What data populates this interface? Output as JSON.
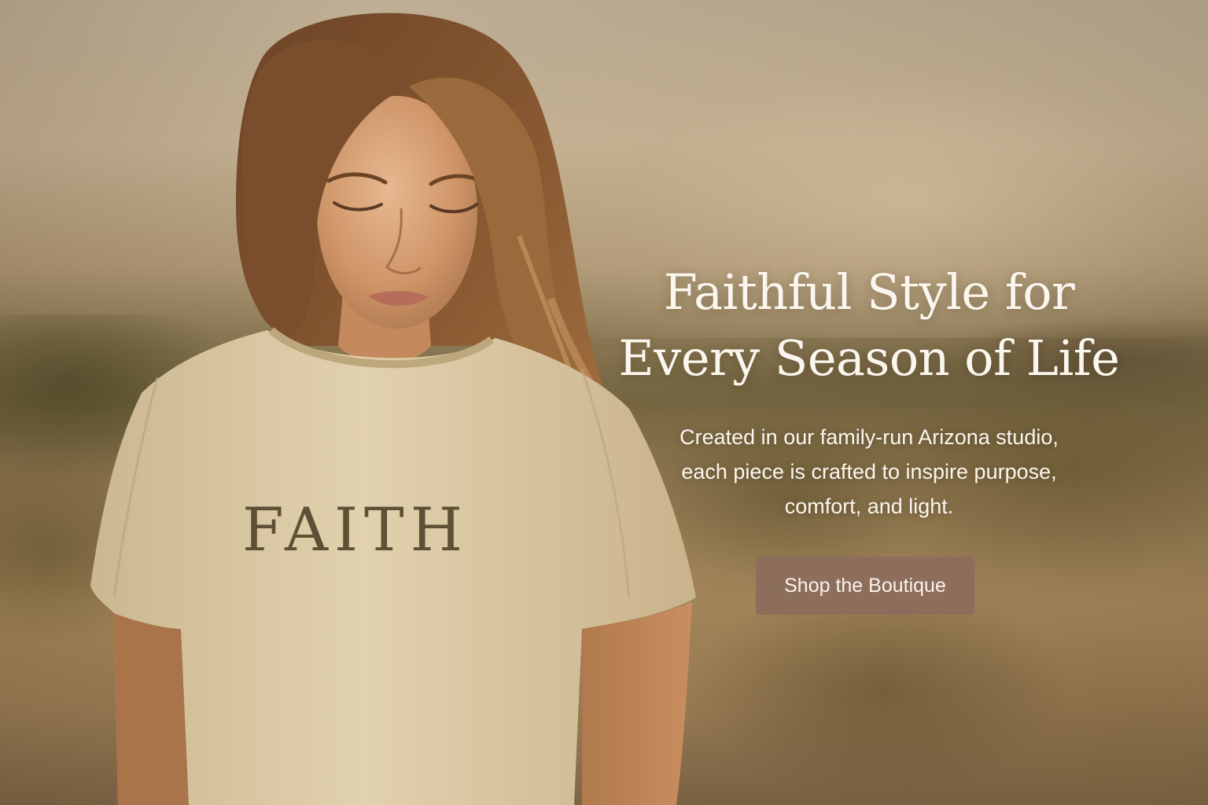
{
  "hero": {
    "headline_line1": "Faithful Style for",
    "headline_line2": "Every Season of Life",
    "subcopy_line1": "Created in our family-run Arizona studio,",
    "subcopy_line2": "each piece is crafted to inspire purpose,",
    "subcopy_line3": "comfort, and light.",
    "cta_label": "Shop the Boutique",
    "shirt_print": "FAITH"
  },
  "colors": {
    "cta_background": "#8b6c5c",
    "text_light": "#fbf6ee",
    "shirt": "#d9c7a4",
    "shirt_print": "#5e5035"
  }
}
